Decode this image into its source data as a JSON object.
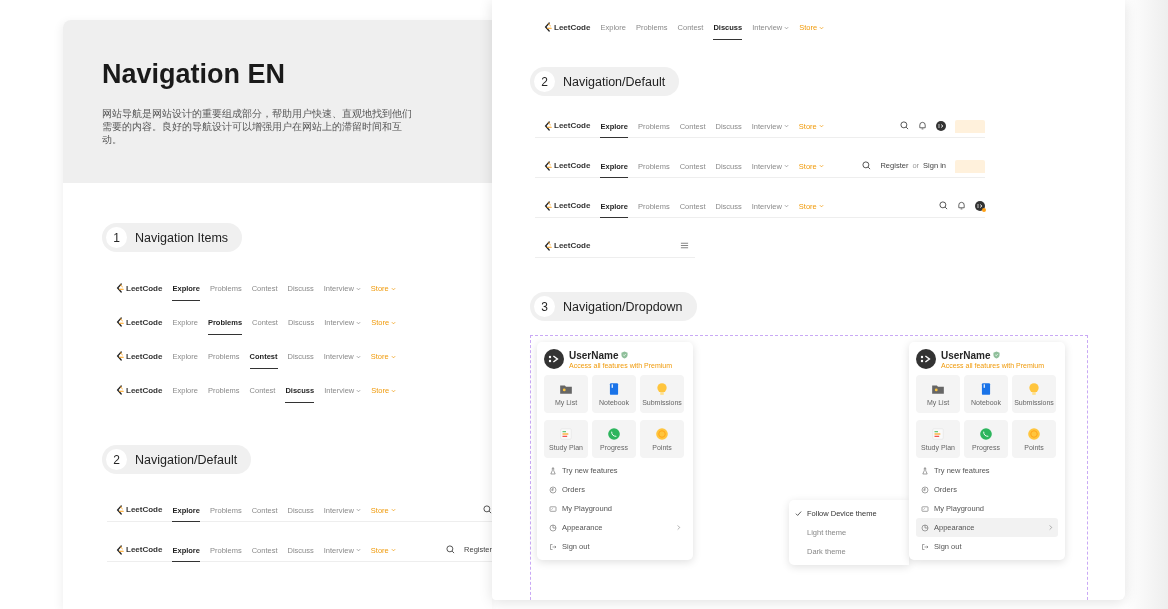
{
  "boards": [
    {
      "title": "Navigation EN",
      "description": "网站导航是网站设计的重要组成部分，帮助用户快速、直观地找到他们需要的内容。良好的导航设计可以增强用户在网站上的滞留时间和互动。",
      "sections": [
        {
          "number": "1",
          "title": "Navigation Items",
          "navbars": [
            {
              "kind": "full",
              "logo": "LeetCode",
              "items": [
                {
                  "label": "Explore",
                  "kind": "link",
                  "selected": true
                },
                {
                  "label": "Problems",
                  "kind": "link",
                  "selected": false
                },
                {
                  "label": "Contest",
                  "kind": "link",
                  "selected": false
                },
                {
                  "label": "Discuss",
                  "kind": "link",
                  "selected": false
                },
                {
                  "label": "Interview",
                  "kind": "dropdown",
                  "selected": false
                },
                {
                  "label": "Store",
                  "kind": "premium",
                  "selected": false
                }
              ]
            },
            {
              "kind": "full",
              "logo": "LeetCode",
              "items": [
                {
                  "label": "Explore",
                  "kind": "link",
                  "selected": false
                },
                {
                  "label": "Problems",
                  "kind": "link",
                  "selected": true
                },
                {
                  "label": "Contest",
                  "kind": "link",
                  "selected": false
                },
                {
                  "label": "Discuss",
                  "kind": "link",
                  "selected": false
                },
                {
                  "label": "Interview",
                  "kind": "dropdown",
                  "selected": false
                },
                {
                  "label": "Store",
                  "kind": "premium",
                  "selected": false
                }
              ]
            },
            {
              "kind": "full",
              "logo": "LeetCode",
              "items": [
                {
                  "label": "Explore",
                  "kind": "link",
                  "selected": false
                },
                {
                  "label": "Problems",
                  "kind": "link",
                  "selected": false
                },
                {
                  "label": "Contest",
                  "kind": "link",
                  "selected": true
                },
                {
                  "label": "Discuss",
                  "kind": "link",
                  "selected": false
                },
                {
                  "label": "Interview",
                  "kind": "dropdown",
                  "selected": false
                },
                {
                  "label": "Store",
                  "kind": "premium",
                  "selected": false
                }
              ]
            },
            {
              "kind": "full",
              "logo": "LeetCode",
              "items": [
                {
                  "label": "Explore",
                  "kind": "link",
                  "selected": false
                },
                {
                  "label": "Problems",
                  "kind": "link",
                  "selected": false
                },
                {
                  "label": "Contest",
                  "kind": "link",
                  "selected": false
                },
                {
                  "label": "Discuss",
                  "kind": "link",
                  "selected": true
                },
                {
                  "label": "Interview",
                  "kind": "dropdown",
                  "selected": false
                },
                {
                  "label": "Store",
                  "kind": "premium",
                  "selected": false
                }
              ]
            }
          ]
        },
        {
          "number": "2",
          "title": "Navigation/Default",
          "navbars": [
            {
              "kind": "full",
              "logo": "LeetCode",
              "divider": true,
              "items": [
                {
                  "label": "Explore",
                  "kind": "link",
                  "selected": true
                },
                {
                  "label": "Problems",
                  "kind": "link",
                  "selected": false
                },
                {
                  "label": "Contest",
                  "kind": "link",
                  "selected": false
                },
                {
                  "label": "Discuss",
                  "kind": "link",
                  "selected": false
                },
                {
                  "label": "Interview",
                  "kind": "dropdown",
                  "selected": false
                },
                {
                  "label": "Store",
                  "kind": "premium",
                  "selected": false
                }
              ],
              "actions": [
                {
                  "kind": "search"
                }
              ]
            },
            {
              "kind": "full",
              "logo": "LeetCode",
              "divider": true,
              "items": [
                {
                  "label": "Explore",
                  "kind": "link",
                  "selected": true
                },
                {
                  "label": "Problems",
                  "kind": "link",
                  "selected": false
                },
                {
                  "label": "Contest",
                  "kind": "link",
                  "selected": false
                },
                {
                  "label": "Discuss",
                  "kind": "link",
                  "selected": false
                },
                {
                  "label": "Interview",
                  "kind": "dropdown",
                  "selected": false
                },
                {
                  "label": "Store",
                  "kind": "premium",
                  "selected": false
                }
              ],
              "actions": [
                {
                  "kind": "search"
                },
                {
                  "kind": "auth",
                  "register": "Register"
                }
              ]
            }
          ]
        }
      ]
    },
    {
      "sections": [
        {
          "navbars": [
            {
              "kind": "full",
              "logo": "LeetCode",
              "items": [
                {
                  "label": "Explore",
                  "kind": "link",
                  "selected": false
                },
                {
                  "label": "Problems",
                  "kind": "link",
                  "selected": false
                },
                {
                  "label": "Contest",
                  "kind": "link",
                  "selected": false
                },
                {
                  "label": "Discuss",
                  "kind": "link",
                  "selected": true
                },
                {
                  "label": "Interview",
                  "kind": "dropdown",
                  "selected": false
                },
                {
                  "label": "Store",
                  "kind": "premium",
                  "selected": false
                }
              ]
            }
          ]
        },
        {
          "number": "2",
          "title": "Navigation/Default",
          "navbars": [
            {
              "kind": "full",
              "logo": "LeetCode",
              "divider": true,
              "items": [
                {
                  "label": "Explore",
                  "kind": "link",
                  "selected": true
                },
                {
                  "label": "Problems",
                  "kind": "link",
                  "selected": false
                },
                {
                  "label": "Contest",
                  "kind": "link",
                  "selected": false
                },
                {
                  "label": "Discuss",
                  "kind": "link",
                  "selected": false
                },
                {
                  "label": "Interview",
                  "kind": "dropdown",
                  "selected": false
                },
                {
                  "label": "Store",
                  "kind": "premium",
                  "selected": false
                }
              ],
              "actions": [
                {
                  "kind": "search"
                },
                {
                  "kind": "bell"
                },
                {
                  "kind": "avatar",
                  "badge": false
                },
                {
                  "kind": "promo"
                }
              ]
            },
            {
              "kind": "full",
              "logo": "LeetCode",
              "divider": true,
              "items": [
                {
                  "label": "Explore",
                  "kind": "link",
                  "selected": true
                },
                {
                  "label": "Problems",
                  "kind": "link",
                  "selected": false
                },
                {
                  "label": "Contest",
                  "kind": "link",
                  "selected": false
                },
                {
                  "label": "Discuss",
                  "kind": "link",
                  "selected": false
                },
                {
                  "label": "Interview",
                  "kind": "dropdown",
                  "selected": false
                },
                {
                  "label": "Store",
                  "kind": "premium",
                  "selected": false
                }
              ],
              "actions": [
                {
                  "kind": "search"
                },
                {
                  "kind": "auth",
                  "register": "Register",
                  "separator": "or",
                  "sign_in": "Sign in"
                },
                {
                  "kind": "promo"
                }
              ]
            },
            {
              "kind": "full",
              "logo": "LeetCode",
              "divider": true,
              "items": [
                {
                  "label": "Explore",
                  "kind": "link",
                  "selected": true
                },
                {
                  "label": "Problems",
                  "kind": "link",
                  "selected": false
                },
                {
                  "label": "Contest",
                  "kind": "link",
                  "selected": false
                },
                {
                  "label": "Discuss",
                  "kind": "link",
                  "selected": false
                },
                {
                  "label": "Interview",
                  "kind": "dropdown",
                  "selected": false
                },
                {
                  "label": "Store",
                  "kind": "premium",
                  "selected": false
                }
              ],
              "actions": [
                {
                  "kind": "search"
                },
                {
                  "kind": "bell"
                },
                {
                  "kind": "avatar",
                  "badge": true
                }
              ]
            },
            {
              "kind": "mobile",
              "logo": "LeetCode",
              "divider": true,
              "actions": [
                {
                  "kind": "menu"
                }
              ]
            }
          ]
        },
        {
          "number": "3",
          "title": "Navigation/Dropdown",
          "dropdowns": [
            {
              "user": "UserName",
              "verified": true,
              "subtitle": "Access all features with Premium",
              "tiles": [
                {
                  "label": "My List",
                  "kind": "folder"
                },
                {
                  "label": "Notebook",
                  "kind": "notebook"
                },
                {
                  "label": "Submissions",
                  "kind": "bulb"
                },
                {
                  "label": "Study Plan",
                  "kind": "plan"
                },
                {
                  "label": "Progress",
                  "kind": "progress"
                },
                {
                  "label": "Points",
                  "kind": "coin"
                }
              ],
              "menu": [
                {
                  "label": "Try new features",
                  "kind": "flask",
                  "selected": false
                },
                {
                  "label": "Orders",
                  "kind": "orders",
                  "selected": false
                },
                {
                  "label": "My Playground",
                  "kind": "playground",
                  "selected": false
                },
                {
                  "label": "Appearance",
                  "kind": "appearance",
                  "selected": false,
                  "submenu": true
                },
                {
                  "label": "Sign out",
                  "kind": "signout",
                  "selected": false
                }
              ]
            },
            {
              "user": "UserName",
              "verified": true,
              "subtitle": "Access all features with Premium",
              "tiles": [
                {
                  "label": "My List",
                  "kind": "folder"
                },
                {
                  "label": "Notebook",
                  "kind": "notebook"
                },
                {
                  "label": "Submissions",
                  "kind": "bulb"
                },
                {
                  "label": "Study Plan",
                  "kind": "plan"
                },
                {
                  "label": "Progress",
                  "kind": "progress"
                },
                {
                  "label": "Points",
                  "kind": "coin"
                }
              ],
              "menu": [
                {
                  "label": "Try new features",
                  "kind": "flask",
                  "selected": false
                },
                {
                  "label": "Orders",
                  "kind": "orders",
                  "selected": false
                },
                {
                  "label": "My Playground",
                  "kind": "playground",
                  "selected": false
                },
                {
                  "label": "Appearance",
                  "kind": "appearance",
                  "selected": true,
                  "submenu": true
                },
                {
                  "label": "Sign out",
                  "kind": "signout",
                  "selected": false
                }
              ],
              "theme_menu": [
                {
                  "label": "Follow Device theme",
                  "selected": true
                },
                {
                  "label": "Light theme",
                  "selected": false
                },
                {
                  "label": "Dark theme",
                  "selected": false
                }
              ]
            }
          ]
        }
      ]
    }
  ]
}
